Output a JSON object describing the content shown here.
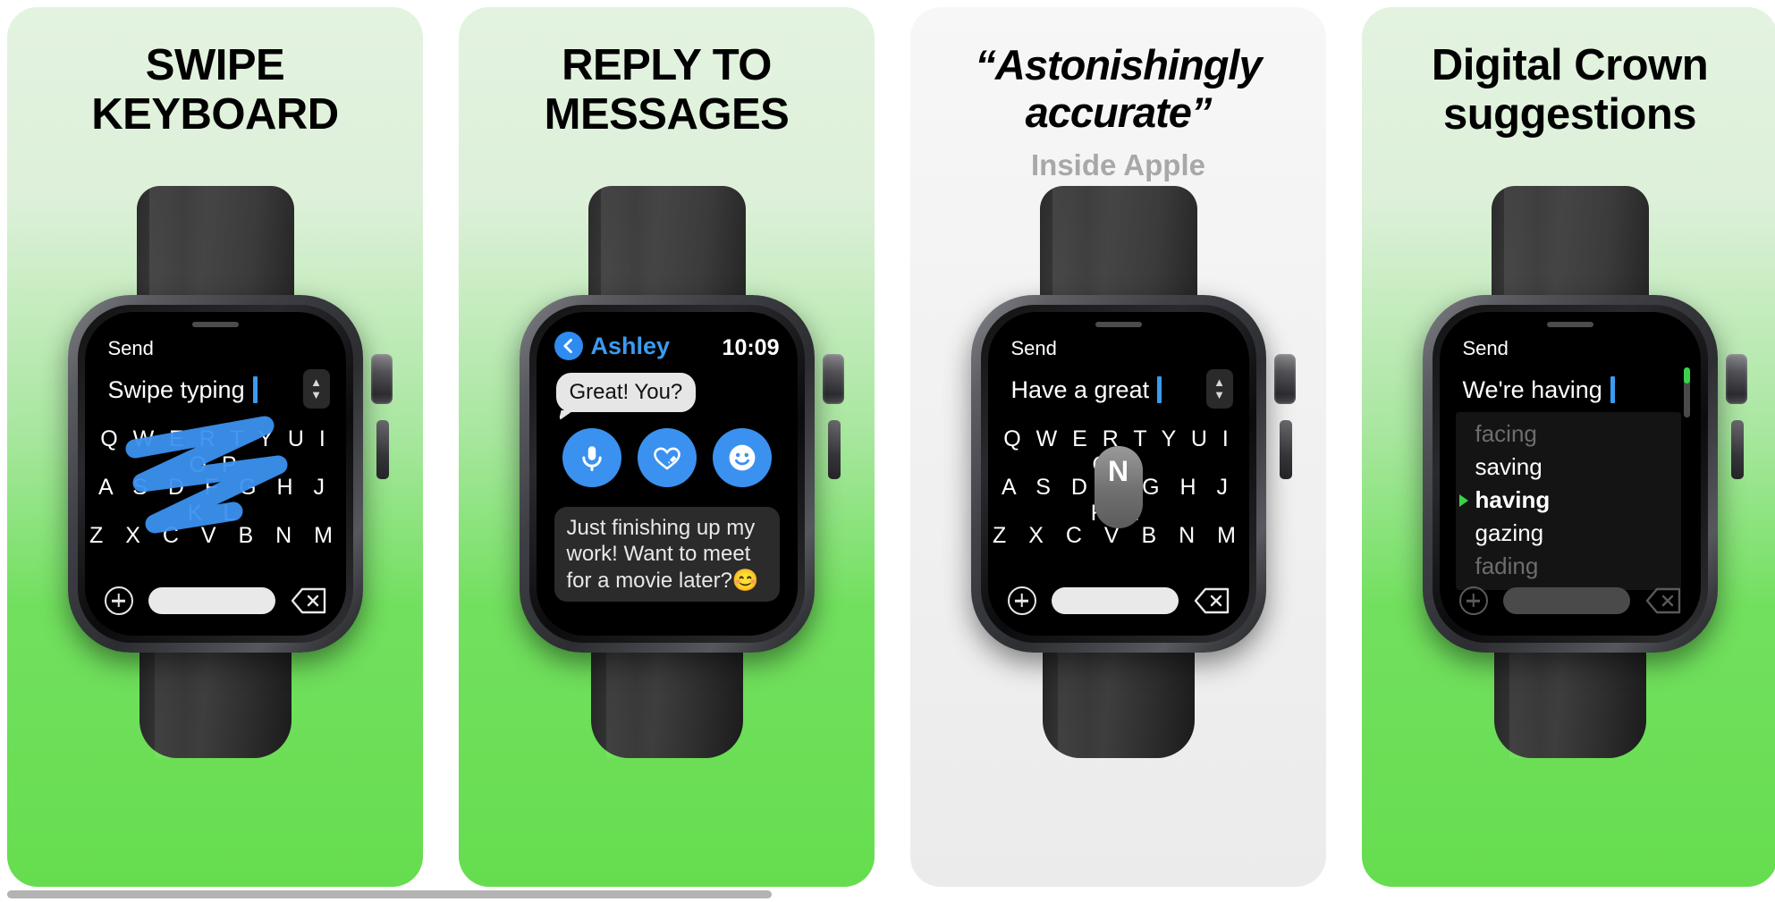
{
  "gallery": {
    "accent_blue": "#3b9bf0",
    "accent_green": "#3ad24a",
    "panels": [
      {
        "id": "swipe-keyboard",
        "background": "green",
        "headline": [
          "SWIPE",
          "KEYBOARD"
        ],
        "subhead": "",
        "screen": {
          "send_label": "Send",
          "text_value": "Swipe typing",
          "keyboard_rows": [
            "Q W E R T Y U I O P",
            "A S D F G H J K L",
            "Z X C V B N M"
          ],
          "stepper_up": "▲",
          "stepper_down": "▼",
          "plus_icon": "plus-icon",
          "space_key": "space-key",
          "delete_icon": "backspace-icon",
          "swipe_trail": "swipe-trail"
        }
      },
      {
        "id": "reply-to-messages",
        "background": "green",
        "headline": [
          "REPLY TO",
          "MESSAGES"
        ],
        "subhead": "",
        "screen": {
          "back_icon": "chevron-left-icon",
          "contact": "Ashley",
          "time": "10:09",
          "incoming_message": "Great! You?",
          "actions": [
            "microphone-icon",
            "scribble-heart-icon",
            "emoji-smiley-icon"
          ],
          "outgoing_message": "Just finishing up my work! Want to meet for a movie later?😊"
        }
      },
      {
        "id": "astonishingly-accurate",
        "background": "white",
        "headline": [
          "“Astonishingly",
          "accurate”"
        ],
        "subhead": "Inside Apple",
        "screen": {
          "send_label": "Send",
          "text_value": "Have a great",
          "keyboard_rows": [
            "Q W E R T Y U I O P",
            "A S D F G H J K L",
            "Z X C V B N M"
          ],
          "key_popup": "N",
          "stepper_up": "▲",
          "stepper_down": "▼",
          "plus_icon": "plus-icon",
          "space_key": "space-key",
          "delete_icon": "backspace-icon"
        }
      },
      {
        "id": "digital-crown-suggestions",
        "background": "green",
        "headline": [
          "Digital Crown",
          "suggestions"
        ],
        "headline_case": "mixed",
        "subhead": "",
        "screen": {
          "send_label": "Send",
          "text_value": "We're having",
          "suggestions": [
            {
              "word": "facing",
              "state": "dimmed"
            },
            {
              "word": "saving",
              "state": "normal"
            },
            {
              "word": "having",
              "state": "active"
            },
            {
              "word": "gazing",
              "state": "normal"
            },
            {
              "word": "fading",
              "state": "dimmed"
            }
          ],
          "scrollbar": "vertical-scrollbar",
          "plus_icon": "plus-icon",
          "space_key": "space-key",
          "delete_icon": "backspace-icon"
        }
      }
    ],
    "page_scrollbar": "horizontal-scrollbar"
  }
}
